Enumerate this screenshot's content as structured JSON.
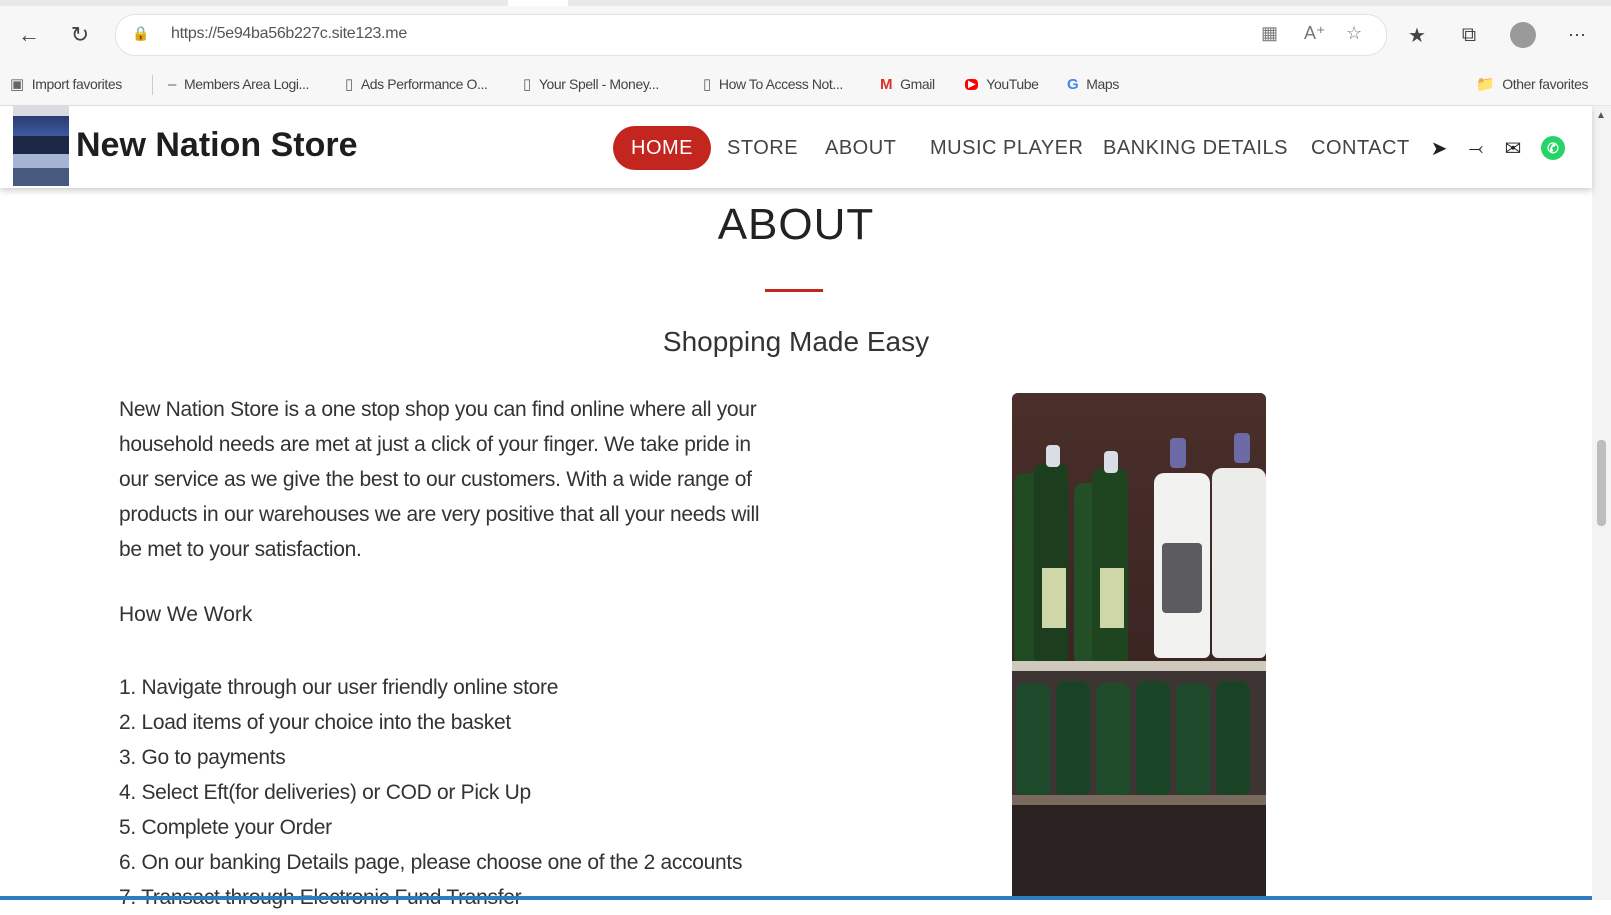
{
  "browser": {
    "url": "https://5e94ba56b227c.site123.me",
    "bookmarks": [
      {
        "label": "Import favorites",
        "icon": "import-icon"
      },
      {
        "label": "Members Area Logi...",
        "icon": "site-icon"
      },
      {
        "label": "Ads Performance O...",
        "icon": "page-icon"
      },
      {
        "label": "Your Spell - Money...",
        "icon": "page-icon"
      },
      {
        "label": "How To Access Not...",
        "icon": "page-icon"
      },
      {
        "label": "Gmail",
        "icon": "gmail-icon"
      },
      {
        "label": "YouTube",
        "icon": "youtube-icon"
      },
      {
        "label": "Maps",
        "icon": "google-icon"
      }
    ],
    "other_favorites": "Other favorites"
  },
  "site": {
    "brand": "New Nation Store",
    "nav": [
      "HOME",
      "STORE",
      "ABOUT",
      "MUSIC PLAYER",
      "BANKING DETAILS",
      "CONTACT"
    ],
    "active_nav": "HOME",
    "accent_color": "#c3251f"
  },
  "about": {
    "title": "ABOUT",
    "subtitle": "Shopping Made Easy",
    "paragraph_lines": [
      "New Nation Store is a one stop shop you can find online where all your",
      "household needs are met at just a click of your finger. We take pride in",
      "our service as we give the best to our customers.  With a wide range of",
      "products in our warehouses we are very positive that all your needs will",
      "be met to your satisfaction."
    ],
    "how_we_work": "How We Work",
    "steps": [
      "1. Navigate through our user friendly online store",
      "2. Load items of your choice into the basket",
      "3. Go to payments",
      "4. Select Eft(for deliveries) or COD or Pick Up",
      "5. Complete your Order",
      "6. On our banking Details page, please choose one of the 2 accounts",
      "7. Transact through Electronic Fund Transfer"
    ]
  }
}
